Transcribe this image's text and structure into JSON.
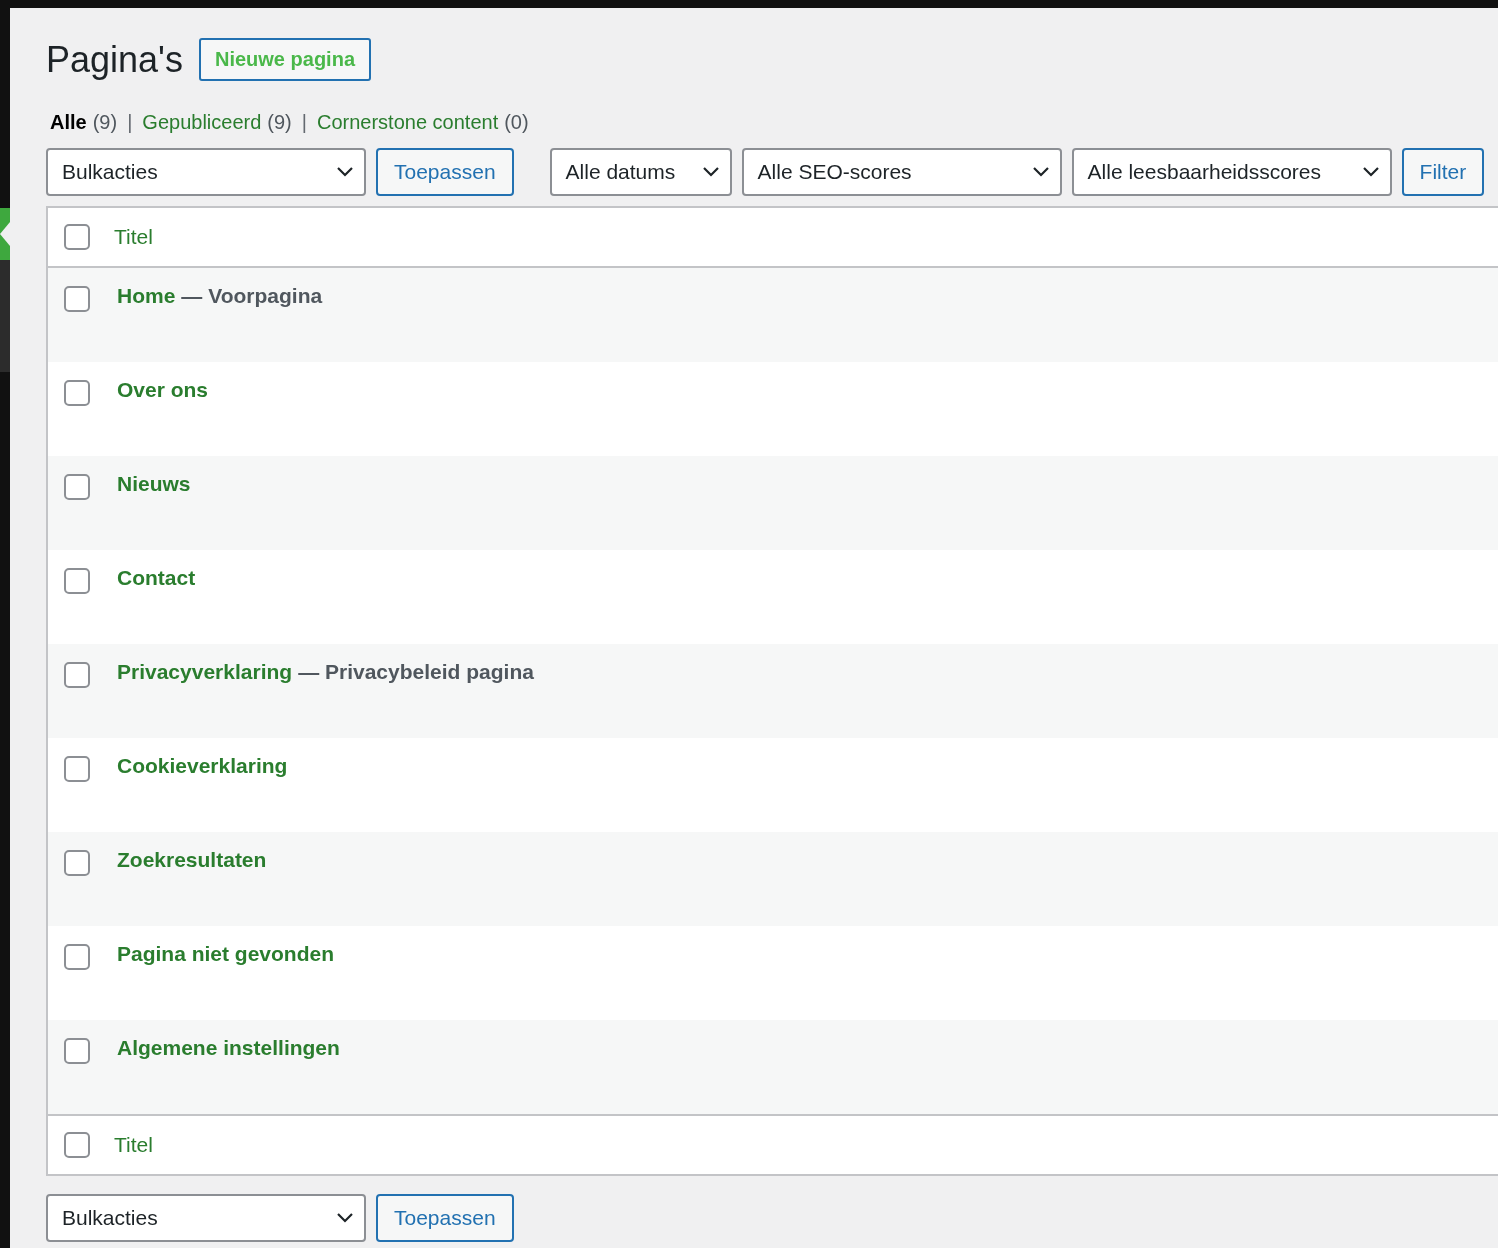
{
  "page": {
    "title": "Pagina's",
    "add_button": "Nieuwe pagina"
  },
  "views": [
    {
      "label": "Alle",
      "count": "(9)",
      "selected": true,
      "separator": "|"
    },
    {
      "label": "Gepubliceerd",
      "count": "(9)",
      "selected": false,
      "separator": "|"
    },
    {
      "label": "Cornerstone content",
      "count": "(0)",
      "selected": false
    }
  ],
  "top_toolbar": [
    {
      "kind": "select",
      "value": "Bulkacties"
    },
    {
      "kind": "button",
      "label": "Toepassen"
    },
    {
      "kind": "spacer"
    },
    {
      "kind": "select",
      "value": "Alle datums"
    },
    {
      "kind": "select",
      "value": "Alle SEO-scores"
    },
    {
      "kind": "select",
      "value": "Alle leesbaarheidsscores"
    },
    {
      "kind": "button",
      "label": "Filter"
    }
  ],
  "table": {
    "header": {
      "column": "Titel",
      "checked": false
    },
    "rows": [
      {
        "title": "Home",
        "suffix": "— Voorpagina",
        "checked": false
      },
      {
        "title": "Over ons",
        "checked": false
      },
      {
        "title": "Nieuws",
        "checked": false
      },
      {
        "title": "Contact",
        "checked": false
      },
      {
        "title": "Privacyverklaring",
        "suffix": "— Privacybeleid pagina",
        "checked": false
      },
      {
        "title": "Cookieverklaring",
        "checked": false
      },
      {
        "title": "Zoekresultaten",
        "checked": false
      },
      {
        "title": "Pagina niet gevonden",
        "checked": false
      },
      {
        "title": "Algemene instellingen",
        "checked": false
      }
    ],
    "footer": {
      "column": "Titel",
      "checked": false
    }
  },
  "bottom_toolbar": [
    {
      "kind": "select",
      "value": "Bulkacties"
    },
    {
      "kind": "button",
      "label": "Toepassen"
    }
  ]
}
